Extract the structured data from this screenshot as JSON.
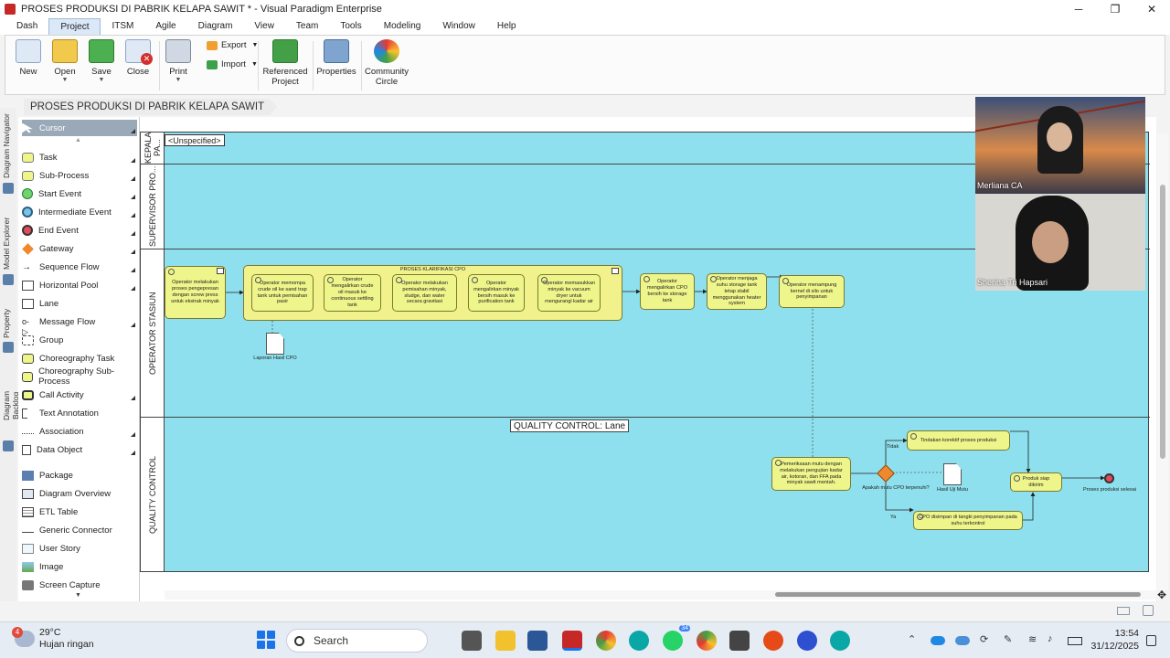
{
  "window": {
    "title": "PROSES PRODUKSI DI PABRIK KELAPA SAWIT * - Visual Paradigm Enterprise"
  },
  "menu": [
    "Dash",
    "Project",
    "ITSM",
    "Agile",
    "Diagram",
    "View",
    "Team",
    "Tools",
    "Modeling",
    "Window",
    "Help"
  ],
  "ribbon": {
    "new": "New",
    "open": "Open",
    "save": "Save",
    "close": "Close",
    "print": "Print",
    "export": "Export",
    "import": "Import",
    "referenced_project": "Referenced Project",
    "properties": "Properties",
    "community_circle": "Community Circle"
  },
  "breadcrumb": "PROSES PRODUKSI DI PABRIK KELAPA SAWIT",
  "side_tabs": [
    "Diagram Navigator",
    "Model Explorer",
    "Property",
    "Diagram Backlog"
  ],
  "palette": [
    "Cursor",
    "Task",
    "Sub-Process",
    "Start Event",
    "Intermediate Event",
    "End Event",
    "Gateway",
    "Sequence Flow",
    "Horizontal Pool",
    "Lane",
    "Message Flow",
    "Group",
    "Choreography Task",
    "Choreography Sub-Process",
    "Call Activity",
    "Text Annotation",
    "Association",
    "Data Object",
    "Package",
    "Diagram Overview",
    "ETL Table",
    "Generic Connector",
    "User Story",
    "Image",
    "Screen Capture"
  ],
  "diagram": {
    "pool_label": "<Unspecified>",
    "lanes": [
      "KEPALA PA...",
      "SUPERVISOR PRO...",
      "OPERATOR STASIUN",
      "QUALITY CONTROL"
    ],
    "subprocess_title": "PROSES KLARIFIKASI CPO",
    "tasks": {
      "t1": "Operator melakukan proses pengepresan dengan screw press untuk ekstrak minyak",
      "t2": "Operator memompa crude oil ke sand trap tank untuk pemisahan pasir",
      "t3": "Operator mengalirkan crude oil masuk ke continuous settling tank",
      "t4": "Operator melakukan pemisahan minyak, sludge, dan water secara gravitasi",
      "t5": "Operator mengalirkan minyak bersih masuk ke purification tank",
      "t6": "Operator memasukkan minyak ke vacuum dryer untuk mengurangi kadar air",
      "t7": "Operator mengalirkan CPO bersih ke storage tank",
      "t8": "Operator menjaga suhu storage tank tetap stabil menggunakan heater system",
      "t9": "Operator menampung kernel di silo untuk penyimpanan",
      "q1": "Pemeriksaan mutu dengan melakukan pengujian kadar air, kotoran, dan FFA pada minyak sawit mentah.",
      "q2": "Tindakan korektif proses produksi",
      "q3": "CPO disimpan di tangki penyimpanan pada suhu terkontrol",
      "q4": "Produk siap dikirim"
    },
    "data_objects": {
      "d1": "Laporan Hasil CPO",
      "d2": "Hasil Uji Mutu"
    },
    "gateway_label": "Apakah mutu CPO terpenuhi?",
    "flow_labels": {
      "no": "Tidak",
      "yes": "Ya"
    },
    "end_label": "Proses produksi selesai",
    "qc_lane_label": "QUALITY CONTROL: Lane"
  },
  "video": {
    "p1": "Merliana CA",
    "p2": "Sherina Tri Hapsari"
  },
  "taskbar": {
    "weather_temp": "29°C",
    "weather_desc": "Hujan ringan",
    "weather_badge": "4",
    "search": "Search",
    "whatsapp_badge": "34",
    "time": "13:54",
    "date": "31/12/2025"
  }
}
